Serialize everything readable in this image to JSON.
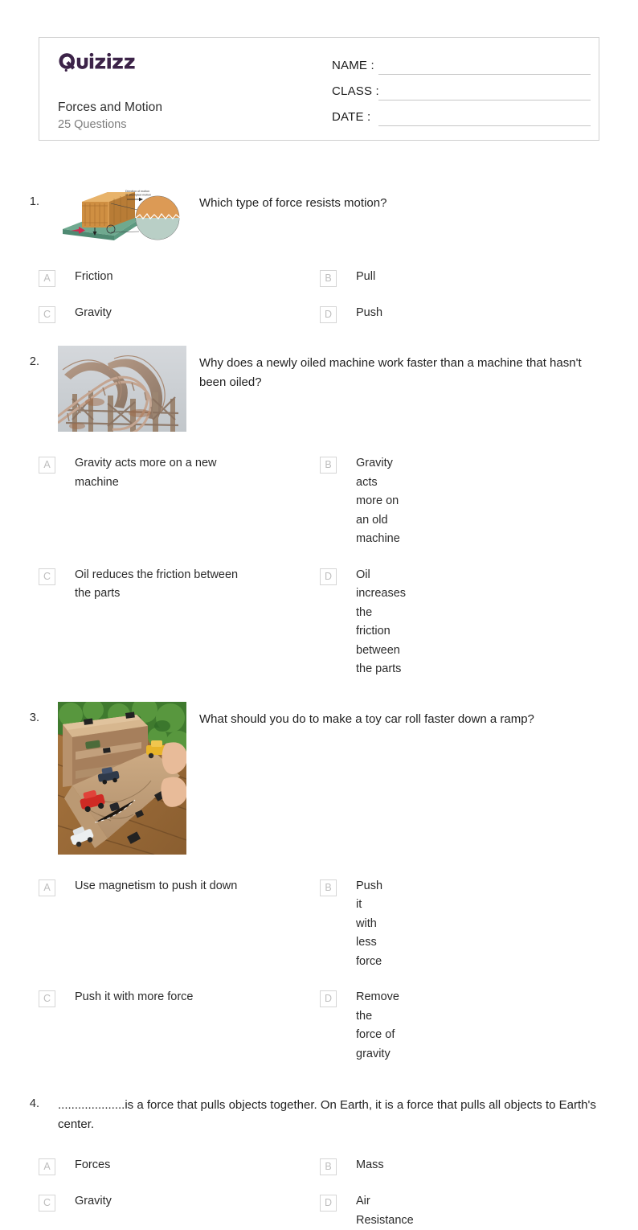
{
  "header": {
    "logo_text": "Quizizz",
    "quiz_title": "Forces and Motion",
    "question_count": "25 Questions",
    "fields": [
      {
        "label": "NAME :",
        "value": ""
      },
      {
        "label": "CLASS :",
        "value": ""
      },
      {
        "label": "DATE  :",
        "value": ""
      }
    ]
  },
  "questions": [
    {
      "number": "1.",
      "text": "Which type of force resists motion?",
      "has_image": true,
      "image_alt": "friction-diagram-crate-on-surface",
      "options": [
        {
          "letter": "A",
          "text": "Friction"
        },
        {
          "letter": "B",
          "text": "Pull"
        },
        {
          "letter": "C",
          "text": "Gravity"
        },
        {
          "letter": "D",
          "text": "Push"
        }
      ]
    },
    {
      "number": "2.",
      "text": "Why does a newly oiled machine work faster than a machine that hasn't been oiled?",
      "has_image": true,
      "image_alt": "old-wooden-roller-coaster-photo",
      "options": [
        {
          "letter": "A",
          "text": "Gravity acts more on a new machine"
        },
        {
          "letter": "B",
          "text": "Gravity acts more on an old machine"
        },
        {
          "letter": "C",
          "text": "Oil reduces the friction between the parts"
        },
        {
          "letter": "D",
          "text": "Oil increases the friction between the parts"
        }
      ]
    },
    {
      "number": "3.",
      "text": "What should you do to make a toy car roll faster down a ramp?",
      "has_image": true,
      "image_alt": "cardboard-ramp-with-toy-cars-photo",
      "options": [
        {
          "letter": "A",
          "text": "Use magnetism to push it down"
        },
        {
          "letter": "B",
          "text": "Push it with less force"
        },
        {
          "letter": "C",
          "text": "Push it with more force"
        },
        {
          "letter": "D",
          "text": "Remove the force of gravity"
        }
      ]
    },
    {
      "number": "4.",
      "text": "....................is a force that pulls objects together. On Earth, it is a force that pulls all objects to Earth's center.",
      "has_image": false,
      "image_alt": "",
      "options": [
        {
          "letter": "A",
          "text": "Forces"
        },
        {
          "letter": "B",
          "text": "Mass"
        },
        {
          "letter": "C",
          "text": "Gravity"
        },
        {
          "letter": "D",
          "text": "Air Resistance"
        }
      ]
    }
  ],
  "colors": {
    "logo_purple": "#3c2348",
    "card_border": "#cfcfcf",
    "field_line": "#c6c6c6",
    "option_box_border": "#d5d5d5",
    "option_letter": "#bdbdbd",
    "subtitle_gray": "#7d7d7d",
    "text_dark": "#2b2b2b"
  }
}
